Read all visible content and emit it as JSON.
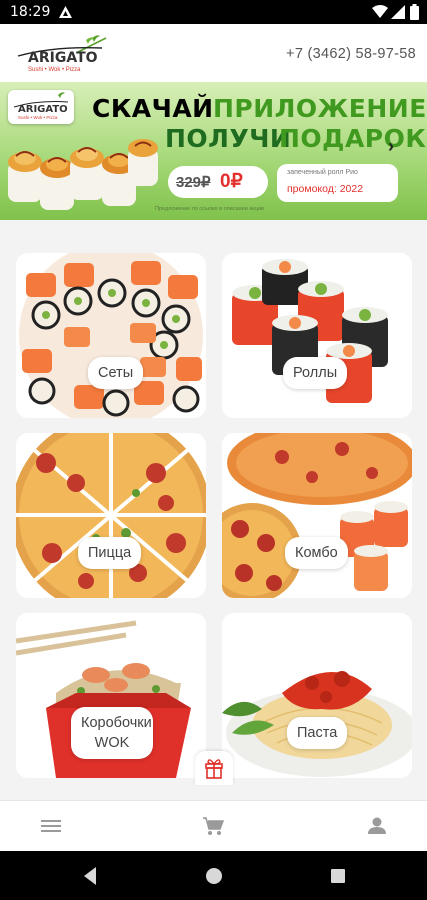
{
  "status_bar": {
    "time": "18:29"
  },
  "header": {
    "brand": "ARIGATO",
    "brand_tagline": "Sushi • Wok • Pizza",
    "phone": "+7 (3462) 58-97-58"
  },
  "banner": {
    "line1_a": "СКАЧАЙ",
    "line1_b": "ПРИЛОЖЕНИЕ",
    "line2_a": "ПОЛУЧИ",
    "line2_b": "ПОДАРОК!",
    "old_price": "329₽",
    "new_price": "0₽",
    "promo_text": "запеченный ролл Рио",
    "promo_code": "промокод: 2022",
    "footnote": "Предложение по ссылке в описании акции"
  },
  "categories": [
    {
      "label": "Сеты"
    },
    {
      "label": "Роллы"
    },
    {
      "label": "Пицца"
    },
    {
      "label": "Комбо"
    },
    {
      "label": "Коробочки WOK"
    },
    {
      "label": "Паста"
    }
  ],
  "bottom_nav": {
    "menu_icon": "menu-icon",
    "cart_icon": "cart-icon",
    "profile_icon": "person-icon"
  },
  "colors": {
    "accent_green": "#3f9a1f",
    "accent_red": "#e2302d",
    "logo_red": "#d63a2f"
  }
}
